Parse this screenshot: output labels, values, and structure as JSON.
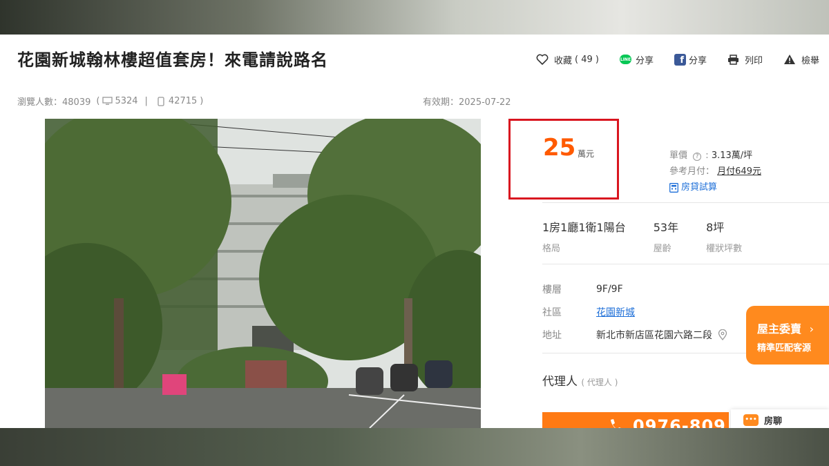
{
  "listing": {
    "title": "花園新城翰林樓超值套房！來電請說路名",
    "actions": {
      "favorite_label": "收藏",
      "favorite_count": "( 49 )",
      "line_label": "分享",
      "fb_label": "分享",
      "print_label": "列印",
      "report_label": "檢舉"
    },
    "stats": {
      "views_label": "瀏覽人數：48039",
      "open_paren": "(",
      "desktop_views": "5324",
      "separator": "|",
      "mobile_views": "42715",
      "close_paren": ")"
    },
    "expiry": "有效期：2025-07-22"
  },
  "price": {
    "amount": "25",
    "unit": "萬元",
    "unit_price_label": "單價",
    "unit_price_value": "3.13萬/坪",
    "monthly_label": "參考月付：",
    "monthly_value": "月付649元",
    "calc_label": "房貸試算"
  },
  "specs": [
    {
      "value": "1房1廳1衛1陽台",
      "label": "格局"
    },
    {
      "value": "53年",
      "label": "屋齡"
    },
    {
      "value": "8坪",
      "label": "權狀坪數"
    }
  ],
  "details": {
    "floor_label": "樓層",
    "floor_value": "9F/9F",
    "community_label": "社區",
    "community_value": "花園新城",
    "address_label": "地址",
    "address_value": "新北市新店區花園六路二段"
  },
  "agent": {
    "label": "代理人",
    "role": "( 代理人 )"
  },
  "call": {
    "phone": "0976-809"
  },
  "owner_banner": {
    "line1": "屋主委賣",
    "line2": "精準匹配客源"
  },
  "chat": {
    "label": "房聊"
  },
  "colors": {
    "price": "#ff5a00",
    "highlight_border": "#d9151f",
    "link": "#1e6fd8",
    "accent": "#ff7a14"
  }
}
